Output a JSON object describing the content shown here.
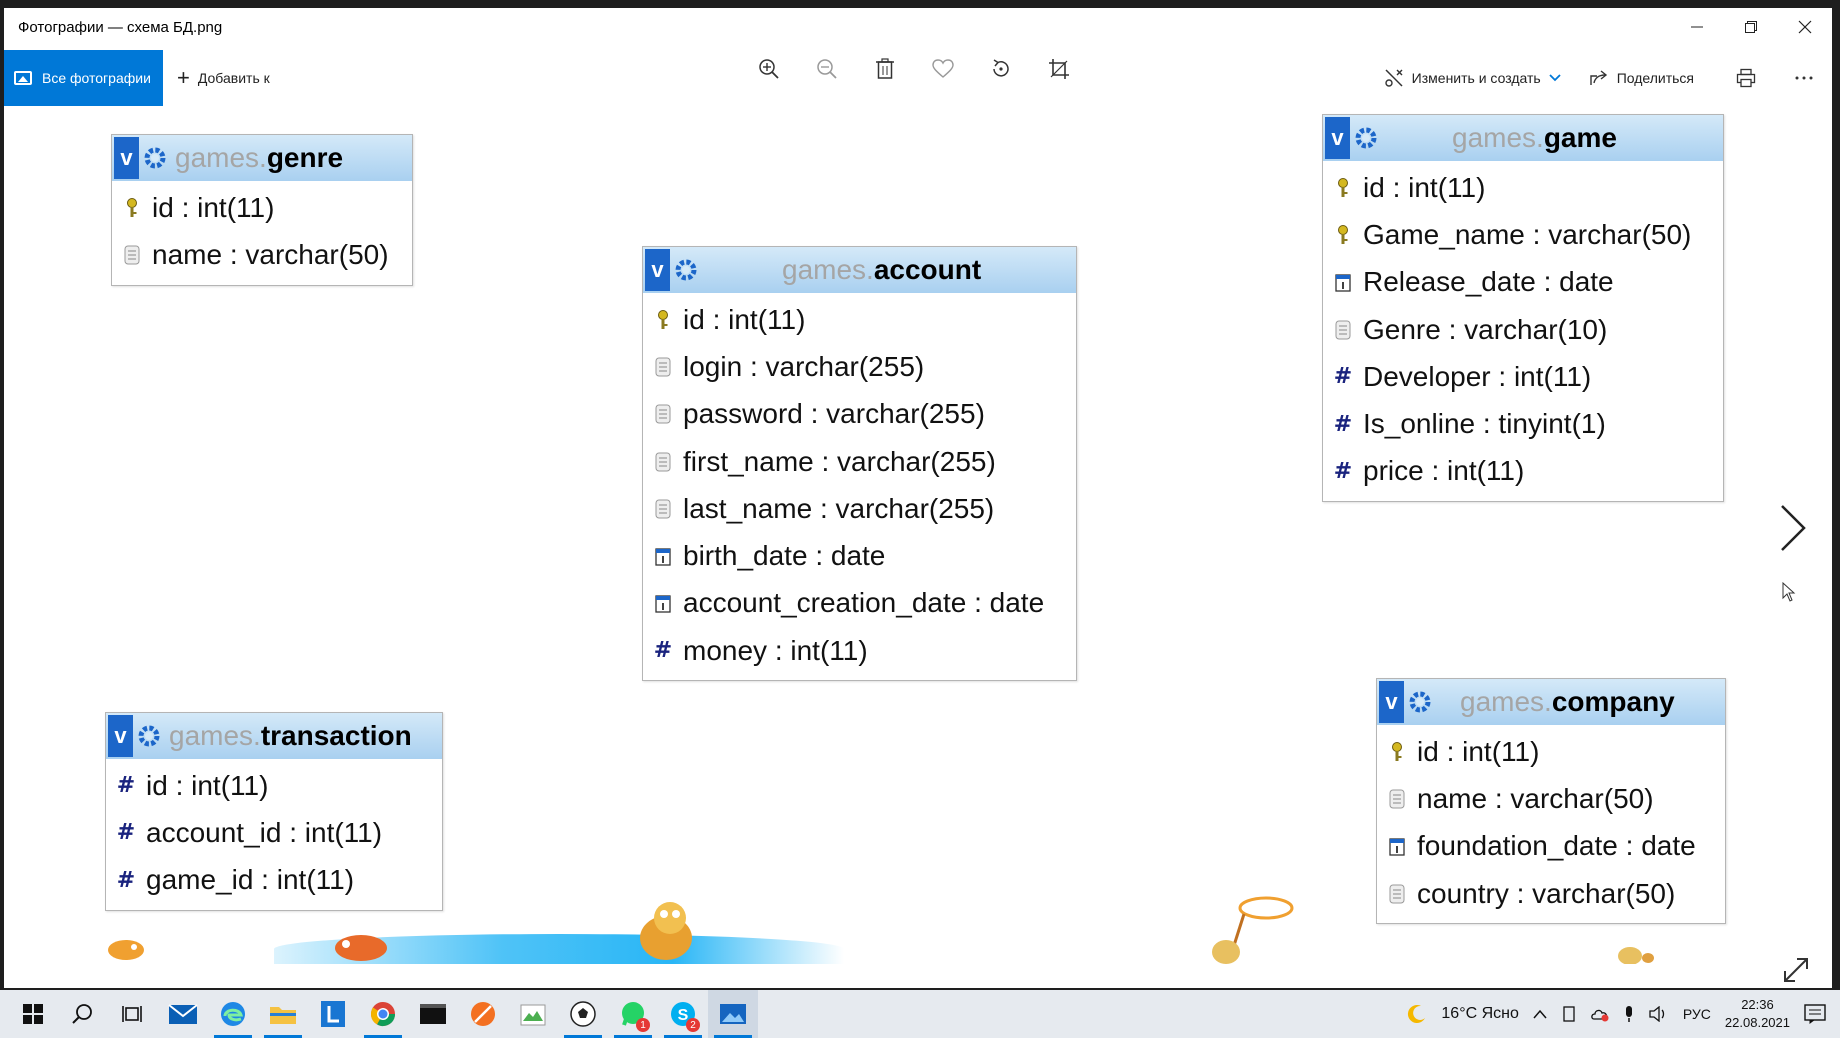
{
  "window": {
    "title": "Фотографии — схема БД.png"
  },
  "toolbar": {
    "all_photos": "Все фотографии",
    "add_to": "Добавить к",
    "edit_create": "Изменить и создать",
    "share": "Поделиться"
  },
  "colors": {
    "accent": "#0078d7",
    "table_header": "#a9d0f0",
    "table_letter_v": "#1c66c9"
  },
  "tables": {
    "genre": {
      "schema": "games.",
      "name": "genre",
      "columns": [
        {
          "icon": "key-icon",
          "text": "id : int(11)"
        },
        {
          "icon": "text-icon",
          "text": "name : varchar(50)"
        }
      ]
    },
    "account": {
      "schema": "games.",
      "name": "account",
      "columns": [
        {
          "icon": "key-icon",
          "text": "id : int(11)"
        },
        {
          "icon": "text-icon",
          "text": "login : varchar(255)"
        },
        {
          "icon": "text-icon",
          "text": "password : varchar(255)"
        },
        {
          "icon": "text-icon",
          "text": "first_name : varchar(255)"
        },
        {
          "icon": "text-icon",
          "text": "last_name : varchar(255)"
        },
        {
          "icon": "date-icon",
          "text": "birth_date : date"
        },
        {
          "icon": "date-icon",
          "text": "account_creation_date : date"
        },
        {
          "icon": "number-icon",
          "text": "money : int(11)"
        }
      ]
    },
    "game": {
      "schema": "games.",
      "name": "game",
      "columns": [
        {
          "icon": "key-icon",
          "text": "id : int(11)"
        },
        {
          "icon": "key-icon",
          "text": "Game_name : varchar(50)"
        },
        {
          "icon": "date-icon",
          "text": "Release_date : date"
        },
        {
          "icon": "text-icon",
          "text": "Genre : varchar(10)"
        },
        {
          "icon": "number-icon",
          "text": "Developer : int(11)"
        },
        {
          "icon": "number-icon",
          "text": "Is_online : tinyint(1)"
        },
        {
          "icon": "number-icon",
          "text": "price : int(11)"
        }
      ]
    },
    "transaction": {
      "schema": "games.",
      "name": "transaction",
      "columns": [
        {
          "icon": "number-icon",
          "text": "id : int(11)"
        },
        {
          "icon": "number-icon",
          "text": "account_id : int(11)"
        },
        {
          "icon": "number-icon",
          "text": "game_id : int(11)"
        }
      ]
    },
    "company": {
      "schema": "games.",
      "name": "company",
      "columns": [
        {
          "icon": "key-icon",
          "text": "id : int(11)"
        },
        {
          "icon": "text-icon",
          "text": "name : varchar(50)"
        },
        {
          "icon": "date-icon",
          "text": "foundation_date : date"
        },
        {
          "icon": "text-icon",
          "text": "country : varchar(50)"
        }
      ]
    }
  },
  "taskbar": {
    "weather": "16°C Ясно",
    "lang": "РУС",
    "time": "22:36",
    "date": "22.08.2021",
    "badges": {
      "whatsapp": "1",
      "skype": "2"
    }
  }
}
